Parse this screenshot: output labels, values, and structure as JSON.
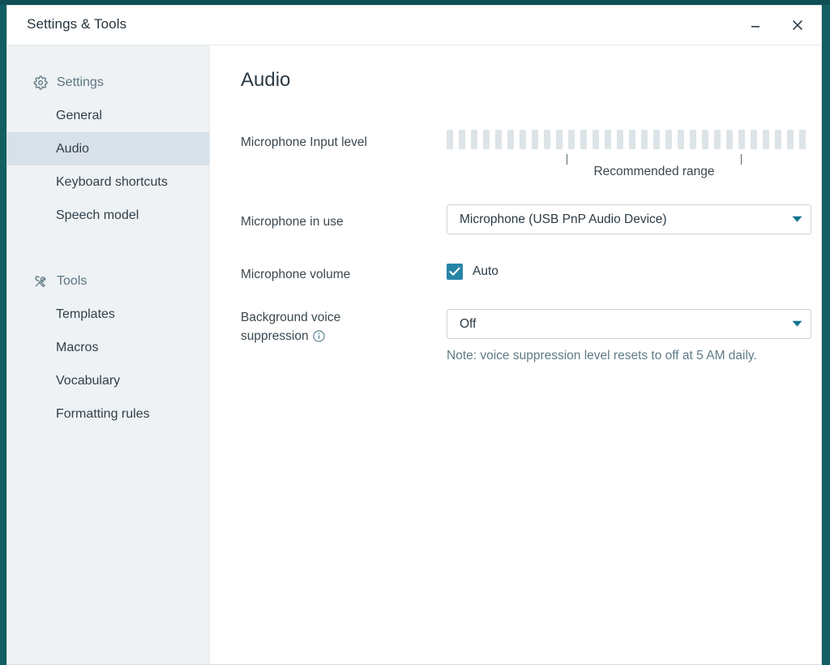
{
  "window": {
    "title": "Settings & Tools",
    "minimize_label": "Minimize",
    "close_label": "Close"
  },
  "sidebar": {
    "groups": [
      {
        "icon": "gear-icon",
        "label": "Settings",
        "items": [
          {
            "label": "General",
            "selected": false
          },
          {
            "label": "Audio",
            "selected": true
          },
          {
            "label": "Keyboard shortcuts",
            "selected": false
          },
          {
            "label": "Speech model",
            "selected": false
          }
        ]
      },
      {
        "icon": "tools-icon",
        "label": "Tools",
        "items": [
          {
            "label": "Templates",
            "selected": false
          },
          {
            "label": "Macros",
            "selected": false
          },
          {
            "label": "Vocabulary",
            "selected": false
          },
          {
            "label": "Formatting rules",
            "selected": false
          }
        ]
      }
    ]
  },
  "main": {
    "page_title": "Audio",
    "input_level": {
      "label": "Microphone Input level",
      "segment_count": 30,
      "active_segments": 0,
      "caption": "Recommended range"
    },
    "microphone": {
      "label": "Microphone in use",
      "value": "Microphone (USB PnP Audio Device)",
      "caret_icon": "chevron-down-icon"
    },
    "volume": {
      "label": "Microphone volume",
      "checkbox_label": "Auto",
      "checked": true
    },
    "suppression": {
      "label": "Background voice suppression",
      "info_icon": "info-icon",
      "value": "Off",
      "caret_icon": "chevron-down-icon",
      "note": "Note: voice suppression level resets to off at 5 AM daily."
    }
  },
  "colors": {
    "accent_teal": "#0f7490",
    "checkbox_fill": "#2685a6",
    "sidebar_bg": "#eef2f4",
    "selected_bg": "#d9e1e8",
    "desktop_bg": "#125e63",
    "note_text": "#5e7b86",
    "meter_segment": "#dde4e8"
  }
}
